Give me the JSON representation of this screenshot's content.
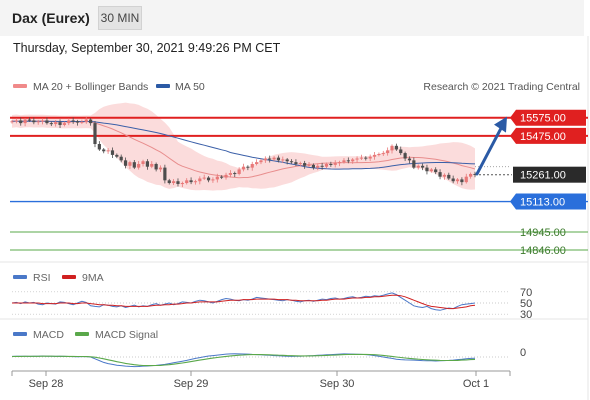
{
  "header": {
    "title": "Dax (Eurex)",
    "timeframe_button": "30 MIN"
  },
  "timestamp": "Thursday, September 30, 2021 9:49:26 PM CET",
  "legend": {
    "items": [
      {
        "label": "MA 20 + Bollinger Bands",
        "color": "#f08a8a"
      },
      {
        "label": "MA 50",
        "color": "#2b5aa5"
      }
    ],
    "copyright": "Research © 2021 Trading Central"
  },
  "colors": {
    "resistance": "#e02020",
    "support_blue": "#2a6fdb",
    "support_green": "#5aa84a",
    "candle_up": "#e87878",
    "candle_down": "#4d4d4d",
    "ma20": "#e88d8d",
    "ma50": "#3a5fa8",
    "bands_fill": "#fbdcdc",
    "arrow": "#2b5aa5",
    "rsi": "#4a78c8",
    "rsi_ma": "#d02020",
    "macd": "#4a78c8",
    "macd_signal": "#5aa84a"
  },
  "chart_data": [
    {
      "type": "candlestick",
      "title": "Dax (Eurex)",
      "timeframe": "30 MIN",
      "ylim": [
        14780,
        15700
      ],
      "x_labels": [
        "Sep 28",
        "Sep 29",
        "Sep 30",
        "Oct 1"
      ],
      "last_price": 15261.0,
      "levels": [
        {
          "value": 15575.0,
          "label": "15575.00",
          "kind": "resistance"
        },
        {
          "value": 15475.0,
          "label": "15475.00",
          "kind": "resistance"
        },
        {
          "value": 15113.0,
          "label": "15113.00",
          "kind": "support"
        },
        {
          "value": 14945.0,
          "label": "14945.00",
          "kind": "support"
        },
        {
          "value": 14846.0,
          "label": "14846.00",
          "kind": "support"
        }
      ],
      "forecast_arrow": {
        "from": 15265,
        "to": 15570
      },
      "closes": [
        15555,
        15560,
        15545,
        15565,
        15560,
        15550,
        15555,
        15560,
        15545,
        15540,
        15550,
        15535,
        15545,
        15560,
        15555,
        15548,
        15552,
        15565,
        15545,
        15430,
        15400,
        15390,
        15395,
        15370,
        15360,
        15340,
        15310,
        15330,
        15300,
        15320,
        15335,
        15305,
        15320,
        15290,
        15300,
        15230,
        15215,
        15225,
        15210,
        15215,
        15230,
        15220,
        15225,
        15240,
        15245,
        15230,
        15235,
        15250,
        15245,
        15260,
        15270,
        15265,
        15290,
        15305,
        15300,
        15320,
        15330,
        15340,
        15350,
        15345,
        15355,
        15340,
        15345,
        15335,
        15330,
        15320,
        15325,
        15310,
        15315,
        15300,
        15310,
        15305,
        15320,
        15315,
        15325,
        15330,
        15340,
        15335,
        15345,
        15350,
        15355,
        15350,
        15360,
        15370,
        15375,
        15380,
        15395,
        15420,
        15400,
        15380,
        15350,
        15340,
        15300,
        15310,
        15300,
        15280,
        15290,
        15275,
        15250,
        15260,
        15240,
        15225,
        15235,
        15220,
        15250,
        15265,
        15261
      ],
      "ma50_start": 15555,
      "ma50_end": 15310
    },
    {
      "type": "line",
      "title": "RSI",
      "series": [
        {
          "name": "RSI",
          "color": "#4a78c8"
        },
        {
          "name": "9MA",
          "color": "#d02020"
        }
      ],
      "y_ticks": [
        30,
        50,
        70
      ],
      "ylim": [
        25,
        75
      ],
      "rsi_values": [
        50,
        51,
        49,
        52,
        50,
        51,
        48,
        47,
        50,
        49,
        48,
        52,
        51,
        49,
        47,
        50,
        53,
        51,
        45,
        44,
        43,
        47,
        46,
        44,
        43,
        45,
        42,
        44,
        46,
        43,
        45,
        44,
        47,
        49,
        46,
        48,
        50,
        47,
        49,
        52,
        51,
        50,
        53,
        55,
        54,
        52,
        50,
        53,
        56,
        58,
        57,
        55,
        54,
        56,
        55,
        57,
        60,
        59,
        58,
        57,
        56,
        55,
        54,
        56,
        55,
        53,
        52,
        54,
        55,
        53,
        55,
        57,
        56,
        58,
        59,
        57,
        58,
        60,
        61,
        59,
        60,
        62,
        61,
        63,
        62,
        64,
        66,
        68,
        65,
        60,
        55,
        50,
        45,
        43,
        42,
        44,
        40,
        38,
        37,
        39,
        41,
        40,
        44,
        47,
        48,
        49,
        50
      ],
      "ma_values": [
        50,
        50,
        50,
        50,
        50,
        50,
        50,
        49,
        49,
        49,
        49,
        50,
        50,
        50,
        49,
        49,
        50,
        50,
        49,
        48,
        47,
        47,
        46,
        46,
        45,
        45,
        44,
        44,
        44,
        44,
        44,
        44,
        45,
        46,
        46,
        47,
        47,
        48,
        48,
        49,
        50,
        50,
        51,
        52,
        52,
        52,
        52,
        52,
        53,
        54,
        55,
        55,
        55,
        56,
        56,
        56,
        57,
        57,
        57,
        57,
        57,
        56,
        56,
        56,
        55,
        55,
        54,
        54,
        54,
        54,
        54,
        55,
        55,
        56,
        57,
        57,
        57,
        58,
        59,
        59,
        59,
        60,
        60,
        61,
        61,
        62,
        63,
        64,
        64,
        63,
        61,
        58,
        55,
        52,
        49,
        46,
        44,
        43,
        42,
        41,
        40,
        40,
        41,
        42,
        43,
        45,
        46
      ]
    },
    {
      "type": "line",
      "title": "MACD",
      "series": [
        {
          "name": "MACD",
          "color": "#4a78c8"
        },
        {
          "name": "MACD Signal",
          "color": "#5aa84a"
        }
      ],
      "y_ticks": [
        0
      ],
      "ylim": [
        -1,
        1
      ],
      "macd_values": [
        0.05,
        0.06,
        0.07,
        0.06,
        0.05,
        0.06,
        0.07,
        0.08,
        0.07,
        0.06,
        0.05,
        0.06,
        0.05,
        0.04,
        0.03,
        0.02,
        0.03,
        0.04,
        0.0,
        -0.15,
        -0.3,
        -0.45,
        -0.55,
        -0.62,
        -0.68,
        -0.72,
        -0.76,
        -0.78,
        -0.8,
        -0.79,
        -0.76,
        -0.75,
        -0.72,
        -0.7,
        -0.66,
        -0.62,
        -0.55,
        -0.48,
        -0.42,
        -0.35,
        -0.28,
        -0.2,
        -0.12,
        -0.05,
        0.02,
        0.08,
        0.12,
        0.16,
        0.2,
        0.24,
        0.26,
        0.27,
        0.26,
        0.25,
        0.24,
        0.22,
        0.2,
        0.18,
        0.16,
        0.14,
        0.12,
        0.1,
        0.08,
        0.06,
        0.05,
        0.06,
        0.07,
        0.08,
        0.1,
        0.12,
        0.14,
        0.16,
        0.18,
        0.2,
        0.22,
        0.24,
        0.26,
        0.25,
        0.24,
        0.23,
        0.22,
        0.2,
        0.17,
        0.12,
        0.06,
        0.0,
        -0.06,
        -0.12,
        -0.18,
        -0.22,
        -0.24,
        -0.25,
        -0.26,
        -0.28,
        -0.3,
        -0.31,
        -0.32,
        -0.33,
        -0.32,
        -0.3,
        -0.28,
        -0.26,
        -0.22,
        -0.18,
        -0.14,
        -0.12,
        -0.1
      ],
      "signal_values": [
        0.04,
        0.05,
        0.05,
        0.06,
        0.06,
        0.06,
        0.06,
        0.07,
        0.07,
        0.07,
        0.06,
        0.06,
        0.06,
        0.05,
        0.05,
        0.04,
        0.04,
        0.03,
        0.02,
        -0.02,
        -0.08,
        -0.15,
        -0.23,
        -0.31,
        -0.39,
        -0.46,
        -0.53,
        -0.59,
        -0.64,
        -0.68,
        -0.71,
        -0.72,
        -0.72,
        -0.71,
        -0.7,
        -0.67,
        -0.64,
        -0.6,
        -0.55,
        -0.5,
        -0.44,
        -0.38,
        -0.32,
        -0.26,
        -0.2,
        -0.14,
        -0.09,
        -0.04,
        0.01,
        0.05,
        0.09,
        0.12,
        0.15,
        0.17,
        0.19,
        0.2,
        0.2,
        0.2,
        0.19,
        0.18,
        0.17,
        0.15,
        0.14,
        0.12,
        0.11,
        0.1,
        0.09,
        0.09,
        0.09,
        0.1,
        0.11,
        0.12,
        0.13,
        0.15,
        0.16,
        0.18,
        0.2,
        0.21,
        0.22,
        0.22,
        0.22,
        0.22,
        0.21,
        0.19,
        0.17,
        0.13,
        0.09,
        0.05,
        0.0,
        -0.04,
        -0.08,
        -0.12,
        -0.15,
        -0.18,
        -0.21,
        -0.23,
        -0.25,
        -0.27,
        -0.28,
        -0.29,
        -0.29,
        -0.29,
        -0.28,
        -0.26,
        -0.24,
        -0.22,
        -0.2
      ]
    }
  ]
}
